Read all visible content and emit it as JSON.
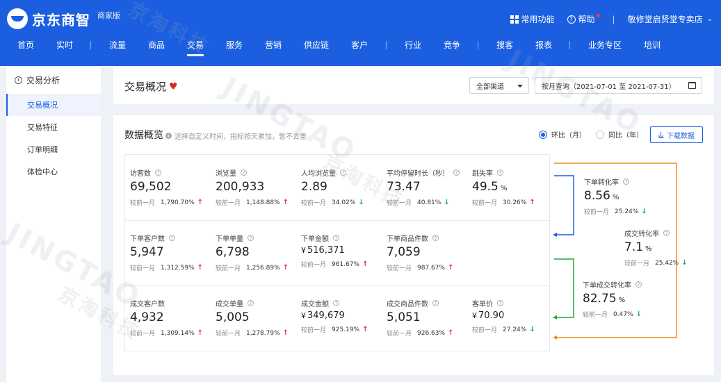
{
  "brand": {
    "name": "京东商智",
    "edition": "商家版"
  },
  "header_right": {
    "common": "常用功能",
    "help": "帮助",
    "shop": "敬修堂启贤堂专卖店"
  },
  "nav": [
    "首页",
    "实时",
    "流量",
    "商品",
    "交易",
    "服务",
    "营销",
    "供应链",
    "客户",
    "行业",
    "竞争",
    "搜客",
    "报表",
    "业务专区",
    "培训"
  ],
  "sidebar": {
    "title": "交易分析",
    "items": [
      "交易概况",
      "交易特征",
      "订单明细",
      "体检中心"
    ]
  },
  "page": {
    "title": "交易概况",
    "channel": "全部渠道",
    "date_range": "按月查询（2021-07-01 至 2021-07-31）"
  },
  "overview": {
    "title": "数据概览",
    "hint": "选择自定义时间，指标按天累加，暂不去重",
    "radio_mom": "环比（月）",
    "radio_yoy": "同比（年）",
    "download": "下载数据",
    "compare_label": "较前一月"
  },
  "metrics": [
    {
      "label": "访客数",
      "value": "69,502",
      "change": "1,790.70%",
      "dir": "up"
    },
    {
      "label": "浏览量",
      "value": "200,933",
      "change": "1,148.88%",
      "dir": "up"
    },
    {
      "label": "人均浏览量",
      "value": "2.89",
      "change": "34.02%",
      "dir": "down"
    },
    {
      "label": "平均停留时长（秒）",
      "value": "73.47",
      "change": "40.81%",
      "dir": "down"
    },
    {
      "label": "跳失率",
      "value": "49.5",
      "unit": "%",
      "change": "30.26%",
      "dir": "up"
    },
    {
      "label": "下单客户数",
      "value": "5,947",
      "change": "1,312.59%",
      "dir": "up"
    },
    {
      "label": "下单单量",
      "value": "6,798",
      "change": "1,256.89%",
      "dir": "up"
    },
    {
      "label": "下单金额",
      "value": "516,371",
      "currency": "¥",
      "change": "961.67%",
      "dir": "up"
    },
    {
      "label": "下单商品件数",
      "value": "7,059",
      "change": "987.67%",
      "dir": "up"
    },
    {
      "label": "成交客户数",
      "value": "4,932",
      "change": "1,309.14%",
      "dir": "up"
    },
    {
      "label": "成交单量",
      "value": "5,005",
      "change": "1,278.79%",
      "dir": "up"
    },
    {
      "label": "成交金额",
      "value": "349,679",
      "currency": "¥",
      "change": "925.19%",
      "dir": "up"
    },
    {
      "label": "成交商品件数",
      "value": "5,051",
      "change": "926.63%",
      "dir": "up"
    },
    {
      "label": "客单价",
      "value": "70.90",
      "currency": "¥",
      "change": "27.24%",
      "dir": "down"
    }
  ],
  "conversions": [
    {
      "label": "下单转化率",
      "value": "8.56",
      "unit": "%",
      "change": "25.24%",
      "dir": "down"
    },
    {
      "label": "成交转化率",
      "value": "7.1",
      "unit": "%",
      "change": "25.42%",
      "dir": "down"
    },
    {
      "label": "下单成交转化率",
      "value": "82.75",
      "unit": "%",
      "change": "0.47%",
      "dir": "down"
    }
  ],
  "colors": {
    "brand_blue": "#1b5fe0",
    "up_red": "#e5302a",
    "down_green": "#1aab3c",
    "flow_orange": "#f08a1d",
    "flow_blue": "#1b5fe0",
    "flow_green": "#1aab3c"
  },
  "watermark": [
    "JINGTAO",
    "京淘科技"
  ]
}
